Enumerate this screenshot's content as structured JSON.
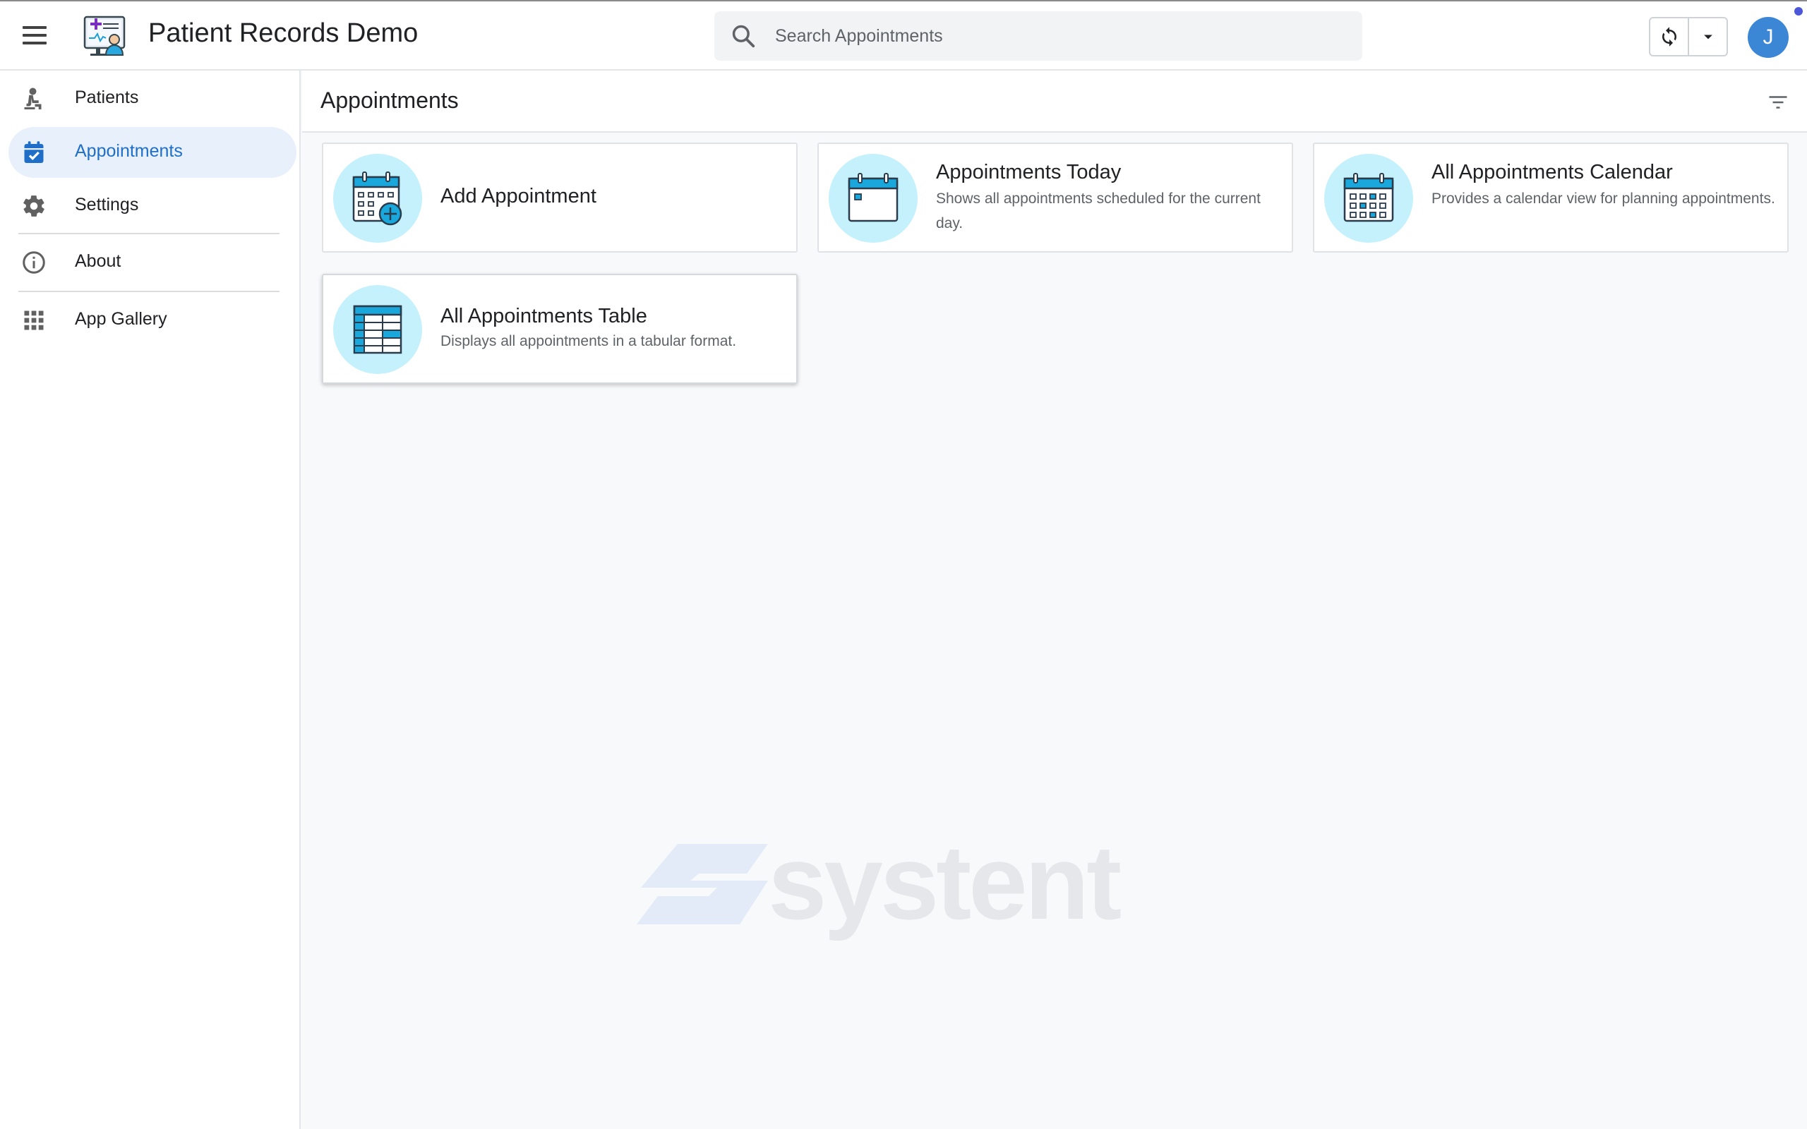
{
  "header": {
    "app_title": "Patient Records Demo",
    "search_placeholder": "Search Appointments",
    "avatar_initial": "J"
  },
  "sidebar": {
    "items": [
      {
        "label": "Patients",
        "icon": "patient-icon"
      },
      {
        "label": "Appointments",
        "icon": "calendar-check-icon",
        "active": true
      },
      {
        "label": "Settings",
        "icon": "gear-icon"
      },
      {
        "label": "About",
        "icon": "info-icon"
      },
      {
        "label": "App Gallery",
        "icon": "grid-icon"
      }
    ]
  },
  "main": {
    "title": "Appointments",
    "cards": [
      {
        "title": "Add Appointment",
        "description": "",
        "icon": "calendar-add-icon"
      },
      {
        "title": "Appointments Today",
        "description": "Shows all appointments scheduled for the current day.",
        "icon": "calendar-day-icon"
      },
      {
        "title": "All Appointments Calendar",
        "description": "Provides a calendar view for planning appointments.",
        "icon": "calendar-month-icon"
      },
      {
        "title": "All Appointments Table",
        "description": "Displays all appointments in a tabular format.",
        "icon": "table-icon"
      }
    ]
  },
  "watermark": {
    "text": "systent"
  },
  "colors": {
    "accent": "#1f6fc8",
    "active_bg": "#e8f0fb",
    "icon_circle": "#c5f1fc",
    "avatar": "#3c86d6"
  }
}
